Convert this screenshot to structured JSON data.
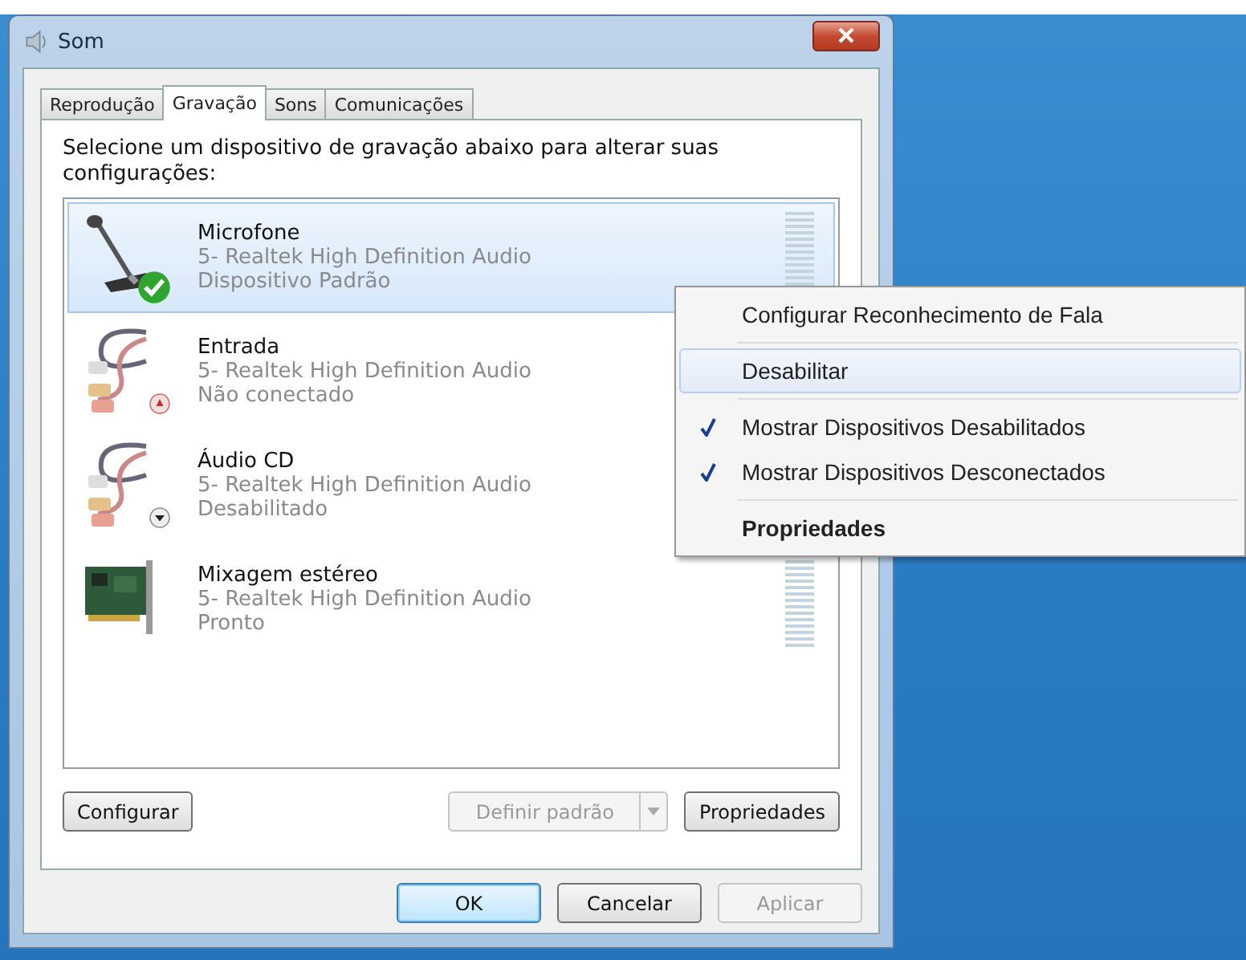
{
  "window": {
    "title": "Som"
  },
  "tabs": [
    {
      "label": "Reprodução",
      "selected": false
    },
    {
      "label": "Gravação",
      "selected": true
    },
    {
      "label": "Sons",
      "selected": false
    },
    {
      "label": "Comunicações",
      "selected": false
    }
  ],
  "instruction": "Selecione um dispositivo de gravação abaixo para alterar suas configurações:",
  "devices": [
    {
      "kind": "microphone",
      "name": "Microfone",
      "driver": "5- Realtek High Definition Audio",
      "status": "Dispositivo Padrão",
      "default": true,
      "unplugged": false,
      "disabled": false,
      "meter": true,
      "selected": true
    },
    {
      "kind": "cable",
      "name": "Entrada",
      "driver": "5- Realtek High Definition Audio",
      "status": "Não conectado",
      "default": false,
      "unplugged": true,
      "disabled": false,
      "meter": false,
      "selected": false
    },
    {
      "kind": "cable",
      "name": "Áudio CD",
      "driver": "5- Realtek High Definition Audio",
      "status": "Desabilitado",
      "default": false,
      "unplugged": false,
      "disabled": true,
      "meter": false,
      "selected": false
    },
    {
      "kind": "card",
      "name": "Mixagem estéreo",
      "driver": "5- Realtek High Definition Audio",
      "status": "Pronto",
      "default": false,
      "unplugged": false,
      "disabled": false,
      "meter": true,
      "selected": false
    }
  ],
  "panel_buttons": [
    {
      "kind": "button",
      "label": "Configurar",
      "disabled": false
    },
    {
      "kind": "split",
      "label": "Definir padrão",
      "disabled": true
    },
    {
      "kind": "button",
      "label": "Propriedades",
      "disabled": false
    }
  ],
  "dialog_buttons": [
    {
      "label": "OK",
      "disabled": false,
      "default": true
    },
    {
      "label": "Cancelar",
      "disabled": false,
      "default": false
    },
    {
      "label": "Aplicar",
      "disabled": true,
      "default": false
    }
  ],
  "context_menu": [
    {
      "kind": "item",
      "label": "Configurar Reconhecimento de Fala",
      "checked": false,
      "selected": false
    },
    {
      "kind": "separator"
    },
    {
      "kind": "item",
      "label": "Desabilitar",
      "checked": false,
      "selected": true
    },
    {
      "kind": "separator"
    },
    {
      "kind": "item",
      "label": "Mostrar Dispositivos Desabilitados",
      "checked": true,
      "selected": false
    },
    {
      "kind": "item",
      "label": "Mostrar Dispositivos Desconectados",
      "checked": true,
      "selected": false
    },
    {
      "kind": "separator"
    },
    {
      "kind": "default",
      "label": "Propriedades",
      "checked": false,
      "selected": false
    }
  ]
}
